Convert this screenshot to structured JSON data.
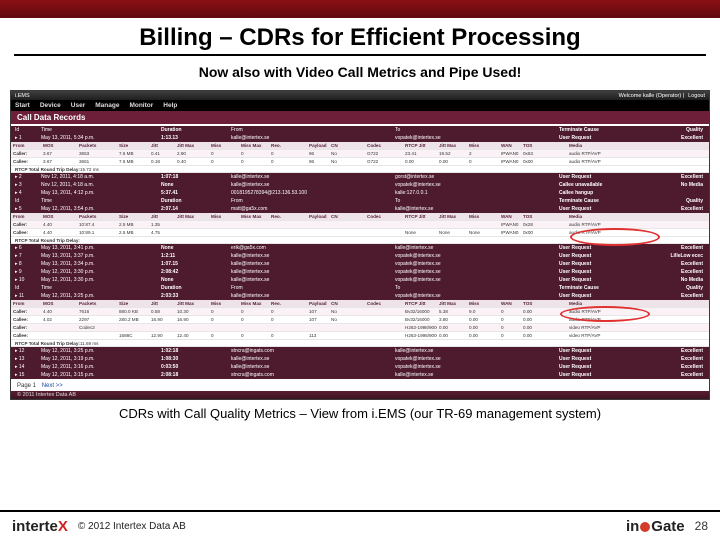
{
  "slide": {
    "title": "Billing – CDRs for Efficient Processing",
    "subtitle": "Now also with Video Call Metrics and Pipe Used!",
    "caption": "CDRs with Call Quality Metrics – View from i.EMS (our TR-69 management system)",
    "pagenum": "28",
    "copyright": "© 2012 Intertex Data AB"
  },
  "iems": {
    "brand": "i.EMS",
    "welcome": "Welcome kalle (Operator) |",
    "logout": "Logout",
    "menu": [
      "Start",
      "Device",
      "User",
      "Manage",
      "Monitor",
      "Help"
    ],
    "cdr_title": "Call Data Records",
    "main_headers": [
      "Id",
      "Time",
      "Duration",
      "From",
      "To",
      "Terminate Cause",
      "Quality"
    ],
    "sub_headers": [
      "From",
      "MOS",
      "Packets",
      "Size",
      "Jitt",
      "Jitt Max",
      "Miss",
      "Miss Max",
      "Reo.",
      "Payload",
      "CN",
      "Codec",
      "RTCP Jitt",
      "Jitt Max",
      "Miss",
      "WAN",
      "TOS",
      "Media"
    ],
    "rtcp_label": "RTCP Total Round Trip Delay:",
    "footer_copy": "© 2011 Intertex Data AB",
    "pager": {
      "label": "Page 1",
      "next": "Next >>"
    },
    "records": [
      {
        "id": "1",
        "time": "May 13, 2011, 5:34 p.m.",
        "dur": "1:13.13",
        "from": "kalle@intertex.se",
        "to": "vopatek@intertex.se",
        "cause": "User Request",
        "quality": "Excellent",
        "caller": {
          "label": "Caller:",
          "mos": "3.67",
          "pkts": "3653",
          "size": "7.6 MB",
          "jit": "0.41",
          "jmax": "2.90",
          "miss": "0",
          "mmax": "0",
          "reo": "0",
          "pl": "96",
          "cn": "No",
          "codec": "G722",
          "rjit": "23.41",
          "rjmax": "19.52",
          "rmiss": "2",
          "wan": "IPWAN0",
          "tos": "0x63",
          "media": "audio RTP/AVP"
        },
        "callee": {
          "label": "Callee:",
          "mos": "3.67",
          "pkts": "3661",
          "size": "7.6 MB",
          "jit": "0.18",
          "jmax": "0.40",
          "miss": "0",
          "mmax": "0",
          "reo": "0",
          "pl": "96",
          "cn": "No",
          "codec": "G722",
          "rjit": "0.00",
          "rjmax": "0.00",
          "rmiss": "0",
          "wan": "IPWAN0",
          "tos": "0x00",
          "media": "audio RTP/AVP"
        },
        "rtcp": "15.72 ms"
      },
      {
        "id": "2",
        "time": "Nov 12, 2011, 4:18 a.m.",
        "dur": "1:07:18",
        "from": "kalle@intertex.se",
        "to": "gorst@intertex.se",
        "cause": "User Request",
        "quality": "Excellent",
        "none": true
      },
      {
        "id": "3",
        "time": "Nov 12, 2011, 4:18 a.m.",
        "dur": "None",
        "from": "kalle@intertex.se",
        "to": "vopatek@intertex.se",
        "cause": "Callee unavailable",
        "quality": "No Media",
        "none": true
      },
      {
        "id": "4",
        "time": "May 13, 2011, 4:12 p.m.",
        "dur": "5:37.41",
        "from": "0018195278394@213.136.53.100",
        "to": "kalle:127.0.0.1",
        "cause": "Callee hangup",
        "quality": "",
        "none": true
      },
      {
        "id": "5",
        "time": "May 12, 2011, 3:54 p.m.",
        "dur": "2:07.14",
        "from": "matt@ga5x.com",
        "to": "kalle@intertex.se",
        "cause": "User Request",
        "quality": "Excellent",
        "caller": {
          "label": "Caller:",
          "mos": "4.40",
          "pkts": "10:87.4",
          "size": "2.5 MB",
          "jit": "1.35",
          "jmax": "",
          "miss": "",
          "mmax": "",
          "reo": "",
          "pl": "",
          "cn": "",
          "codec": "",
          "rjit": "",
          "rjmax": "",
          "rmiss": "",
          "wan": "IPWAN0",
          "tos": "0x28",
          "media": "audio RTP/AVP"
        },
        "callee": {
          "label": "Callee:",
          "mos": "4.40",
          "pkts": "10:89.1",
          "size": "2.5 MB",
          "jit": "4.75",
          "jmax": "",
          "miss": "",
          "mmax": "",
          "reo": "",
          "pl": "",
          "cn": "",
          "codec": "",
          "rjit": "None",
          "rjmax": "None",
          "rmiss": "None",
          "wan": "IPWAN0",
          "tos": "0x00",
          "media": "audio RTP/AVP"
        },
        "rtcp": ""
      },
      {
        "id": "6",
        "time": "May 13, 2011, 3:41 p.m.",
        "dur": "None",
        "from": "erik@ga5x.com",
        "to": "kalle@intertex.se",
        "cause": "User Request",
        "quality": "Excellent",
        "none": true
      },
      {
        "id": "7",
        "time": "May 13, 2011, 3:37 p.m.",
        "dur": "1:2:11",
        "from": "kalle@intertex.se",
        "to": "vopatek@intertex.se",
        "cause": "User Request",
        "quality": "LilleLow ecec",
        "none": true
      },
      {
        "id": "8",
        "time": "May 13, 2011, 3:34 p.m.",
        "dur": "1:07.15",
        "from": "kalle@intertex.se",
        "to": "vopatek@intertex.se",
        "cause": "User Request",
        "quality": "Excellent",
        "none": true
      },
      {
        "id": "9",
        "time": "May 12, 2011, 3:30 p.m.",
        "dur": "2:08:42",
        "from": "kalle@intertex.se",
        "to": "vopatek@intertex.se",
        "cause": "User Request",
        "quality": "Excellent",
        "none": true
      },
      {
        "id": "10",
        "time": "May 12, 2011, 3:30 p.m.",
        "dur": "None",
        "from": "kalle@intertex.se",
        "to": "vopatek@intertex.se",
        "cause": "User Request",
        "quality": "No Media",
        "none": true
      },
      {
        "id": "11",
        "time": "May 12, 2011, 3:25 p.m.",
        "dur": "2:03:33",
        "from": "kalle@intertex.se",
        "to": "vopatek@intertex.se",
        "cause": "User Request",
        "quality": "Excellent",
        "caller": {
          "label": "Caller:",
          "mos": "4.40",
          "pkts": "7616",
          "size": "880.0 KB",
          "jit": "0.58",
          "jmax": "10.30",
          "miss": "0",
          "mmax": "0",
          "reo": "0",
          "pl": "107",
          "cn": "No",
          "codec": "",
          "rjit": "Bv32/16000",
          "rjmax": "5.38",
          "rmiss": "9.0",
          "wan": "0",
          "tos": "0.00",
          "media": "audio RTP/AVP"
        },
        "callee": {
          "label": "Callee:",
          "mos": "4.02",
          "pkts": "2297",
          "size": "280.2 MB",
          "jit": "16.90",
          "jmax": "16.90",
          "miss": "0",
          "mmax": "0",
          "reo": "0",
          "pl": "107",
          "cn": "No",
          "codec": "",
          "rjit": "Bv32/16000",
          "rjmax": "3.80",
          "rmiss": "0.00",
          "wan": "0",
          "tos": "0.00",
          "media": "audio RTP/AVP"
        },
        "callerv": {
          "label": "Caller:",
          "mos": "",
          "pkts": "Codec2",
          "size": "",
          "jit": "",
          "jmax": "",
          "miss": "",
          "mmax": "",
          "reo": "",
          "pl": "",
          "cn": "",
          "codec": "",
          "rjit": "H263-1998/90000",
          "rjmax": "0.00",
          "rmiss": "0.00",
          "wan": "0",
          "tos": "0.00",
          "media": "video RTP/AVP"
        },
        "calleev": {
          "label": "Callee:",
          "mos": "",
          "pkts": "",
          "size": "1688C",
          "jit": "12.90",
          "jmax": "12.40",
          "miss": "0",
          "mmax": "0",
          "reo": "0",
          "pl": "113",
          "cn": "",
          "codec": "",
          "rjit": "H263-1998/90000",
          "rjmax": "0.00",
          "rmiss": "0.00",
          "wan": "0",
          "tos": "0.00",
          "media": "video RTP/AVP"
        },
        "rtcp": "11.69 ms"
      },
      {
        "id": "12",
        "time": "May 12, 2011, 3:25 p.m.",
        "dur": "1:02:18",
        "from": "stncra@ingats.com",
        "to": "kalle@intertex.se",
        "cause": "User Request",
        "quality": "Excellent",
        "none": true
      },
      {
        "id": "13",
        "time": "May 12, 2011, 3:19 p.m.",
        "dur": "1:08:30",
        "from": "kalle@intertex.se",
        "to": "vopatek@intertex.se",
        "cause": "User Request",
        "quality": "Excellent",
        "none": true
      },
      {
        "id": "14",
        "time": "May 12, 2011, 3:16 p.m.",
        "dur": "0:03:50",
        "from": "kalle@intertex.se",
        "to": "vopatek@intertex.se",
        "cause": "User Request",
        "quality": "Excellent",
        "none": true
      },
      {
        "id": "15",
        "time": "May 12, 2011, 3:15 p.m.",
        "dur": "2:08:18",
        "from": "stncra@ingats.com",
        "to": "kalle@intertex.se",
        "cause": "User Request",
        "quality": "Excellent",
        "none": true
      }
    ]
  }
}
